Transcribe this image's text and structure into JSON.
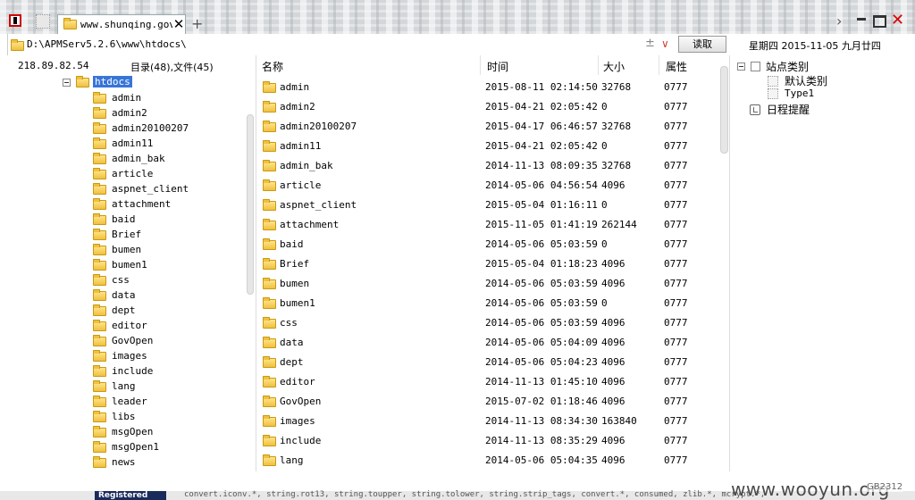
{
  "tab": {
    "title": "www.shunqing.gov.cn"
  },
  "address": {
    "path": "D:\\APMServ5.2.6\\www\\htdocs\\",
    "read_button": "读取"
  },
  "date_display": "星期四 2015-11-05 九月廿四",
  "left": {
    "ip": "218.89.82.54",
    "summary": "目录(48),文件(45)",
    "root": "htdocs",
    "items": [
      "admin",
      "admin2",
      "admin20100207",
      "admin11",
      "admin_bak",
      "article",
      "aspnet_client",
      "attachment",
      "baid",
      "Brief",
      "bumen",
      "bumen1",
      "css",
      "data",
      "dept",
      "editor",
      "GovOpen",
      "images",
      "include",
      "lang",
      "leader",
      "libs",
      "msgOpen",
      "msgOpen1",
      "news"
    ]
  },
  "table": {
    "headers": {
      "name": "名称",
      "time": "时间",
      "size": "大小",
      "attr": "属性"
    },
    "rows": [
      {
        "name": "admin",
        "time": "2015-08-11 02:14:50",
        "size": "32768",
        "attr": "0777"
      },
      {
        "name": "admin2",
        "time": "2015-04-21 02:05:42",
        "size": "0",
        "attr": "0777"
      },
      {
        "name": "admin20100207",
        "time": "2015-04-17 06:46:57",
        "size": "32768",
        "attr": "0777"
      },
      {
        "name": "admin11",
        "time": "2015-04-21 02:05:42",
        "size": "0",
        "attr": "0777"
      },
      {
        "name": "admin_bak",
        "time": "2014-11-13 08:09:35",
        "size": "32768",
        "attr": "0777"
      },
      {
        "name": "article",
        "time": "2014-05-06 04:56:54",
        "size": "4096",
        "attr": "0777"
      },
      {
        "name": "aspnet_client",
        "time": "2015-05-04 01:16:11",
        "size": "0",
        "attr": "0777"
      },
      {
        "name": "attachment",
        "time": "2015-11-05 01:41:19",
        "size": "262144",
        "attr": "0777"
      },
      {
        "name": "baid",
        "time": "2014-05-06 05:03:59",
        "size": "0",
        "attr": "0777"
      },
      {
        "name": "Brief",
        "time": "2015-05-04 01:18:23",
        "size": "4096",
        "attr": "0777"
      },
      {
        "name": "bumen",
        "time": "2014-05-06 05:03:59",
        "size": "4096",
        "attr": "0777"
      },
      {
        "name": "bumen1",
        "time": "2014-05-06 05:03:59",
        "size": "0",
        "attr": "0777"
      },
      {
        "name": "css",
        "time": "2014-05-06 05:03:59",
        "size": "4096",
        "attr": "0777"
      },
      {
        "name": "data",
        "time": "2014-05-06 05:04:09",
        "size": "4096",
        "attr": "0777"
      },
      {
        "name": "dept",
        "time": "2014-05-06 05:04:23",
        "size": "4096",
        "attr": "0777"
      },
      {
        "name": "editor",
        "time": "2014-11-13 01:45:10",
        "size": "4096",
        "attr": "0777"
      },
      {
        "name": "GovOpen",
        "time": "2015-07-02 01:18:46",
        "size": "4096",
        "attr": "0777"
      },
      {
        "name": "images",
        "time": "2014-11-13 08:34:30",
        "size": "163840",
        "attr": "0777"
      },
      {
        "name": "include",
        "time": "2014-11-13 08:35:29",
        "size": "4096",
        "attr": "0777"
      },
      {
        "name": "lang",
        "time": "2014-05-06 05:04:35",
        "size": "4096",
        "attr": "0777"
      }
    ]
  },
  "right": {
    "site_category": "站点类别",
    "default_category": "默认类别",
    "type1": "Type1",
    "schedule": "日程提醒"
  },
  "bottom": {
    "left_label": "Registered",
    "code_text": "convert.iconv.*, string.rot13, string.toupper, string.tolower, string.strip_tags, convert.*, consumed, zlib.*, mcrypt.*,"
  },
  "watermark": "www.wooyun.org",
  "charset": "GB2312",
  "colors": {
    "selection": "#3875d7",
    "close": "#dd0000",
    "folder": "#f0c040"
  }
}
